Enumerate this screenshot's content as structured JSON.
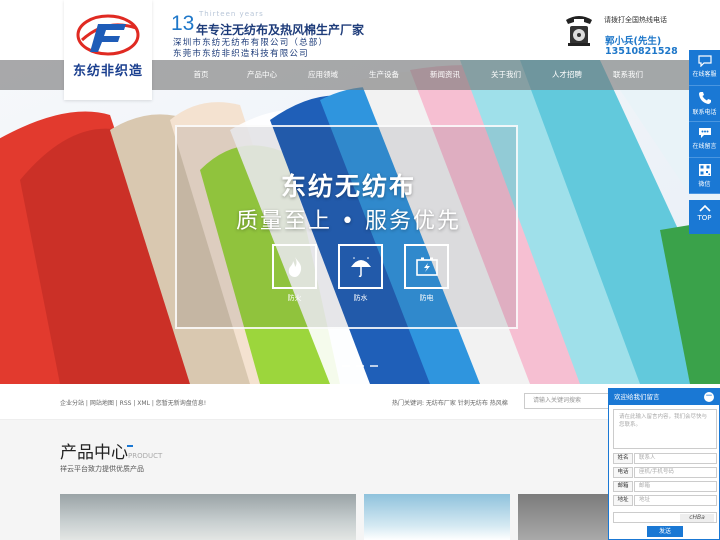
{
  "header": {
    "logo_text": "东纺非织造",
    "slogan_num": "13",
    "slogan_text": "年专注无纺布及热风棉生产厂家",
    "slogan_years": "Thirteen years",
    "company_1": "深圳市东纺无纺布有限公司（总部）",
    "company_2": "东莞市东纺非织造科技有限公司",
    "hotline_label": "请拨打全国热线电话",
    "contact_name": "郭小兵(先生)",
    "contact_phone": "13510821528"
  },
  "nav": {
    "items": [
      "首页",
      "产品中心",
      "应用领域",
      "生产设备",
      "新闻资讯",
      "关于我们",
      "人才招聘",
      "联系我们"
    ]
  },
  "hero": {
    "title": "东纺无纺布",
    "subtitle": "质量至上 • 服务优先",
    "features": [
      "防火",
      "防水",
      "防电"
    ]
  },
  "sidebar": {
    "items": [
      "在线客服",
      "联系电话",
      "在线留言",
      "微信"
    ],
    "top_label": "TOP"
  },
  "strip": {
    "links": "企业分站 | 网站地图 | RSS | XML | 您暂无新询盘信息!",
    "keywords": "热门关键词:  无纺布厂家  针刺无纺布  热风棉",
    "search_placeholder": "请输入关键词搜索"
  },
  "products": {
    "title": "产品中心",
    "title_en": "PRODUCT",
    "desc": "祥云平台致力提供优质产品"
  },
  "message": {
    "header": "欢迎给我们留言",
    "content_placeholder": "请在此输入留言内容，我们会尽快与您联系。",
    "fields": [
      {
        "label": "姓名",
        "placeholder": "联系人"
      },
      {
        "label": "电话",
        "placeholder": "座机/手机号码"
      },
      {
        "label": "邮箱",
        "placeholder": "邮箱"
      },
      {
        "label": "地址",
        "placeholder": "地址"
      }
    ],
    "captcha": "cHBa",
    "send": "发送"
  },
  "colors": {
    "accent": "#1a78d4",
    "nav_bg": "#7b7b7b"
  }
}
